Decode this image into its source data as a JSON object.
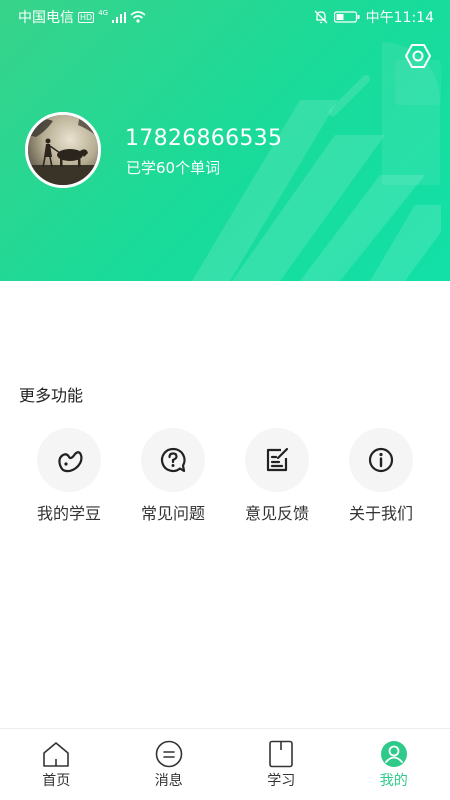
{
  "status_bar": {
    "carrier": "中国电信",
    "hd": "HD",
    "network": "4G",
    "time": "中午11:14"
  },
  "profile": {
    "phone": "17826866535",
    "learned_text": "已学60个单词"
  },
  "more_functions": {
    "title": "更多功能",
    "items": [
      {
        "label": "我的学豆",
        "icon": "bean-icon"
      },
      {
        "label": "常见问题",
        "icon": "question-icon"
      },
      {
        "label": "意见反馈",
        "icon": "feedback-icon"
      },
      {
        "label": "关于我们",
        "icon": "info-icon"
      }
    ]
  },
  "bottom_nav": {
    "items": [
      {
        "label": "首页",
        "icon": "home-icon"
      },
      {
        "label": "消息",
        "icon": "message-icon"
      },
      {
        "label": "学习",
        "icon": "book-icon"
      },
      {
        "label": "我的",
        "icon": "user-icon"
      }
    ],
    "active": "我的"
  },
  "colors": {
    "header_start": "#38d38a",
    "header_end": "#12e0a7",
    "accent": "#2fc98a"
  }
}
